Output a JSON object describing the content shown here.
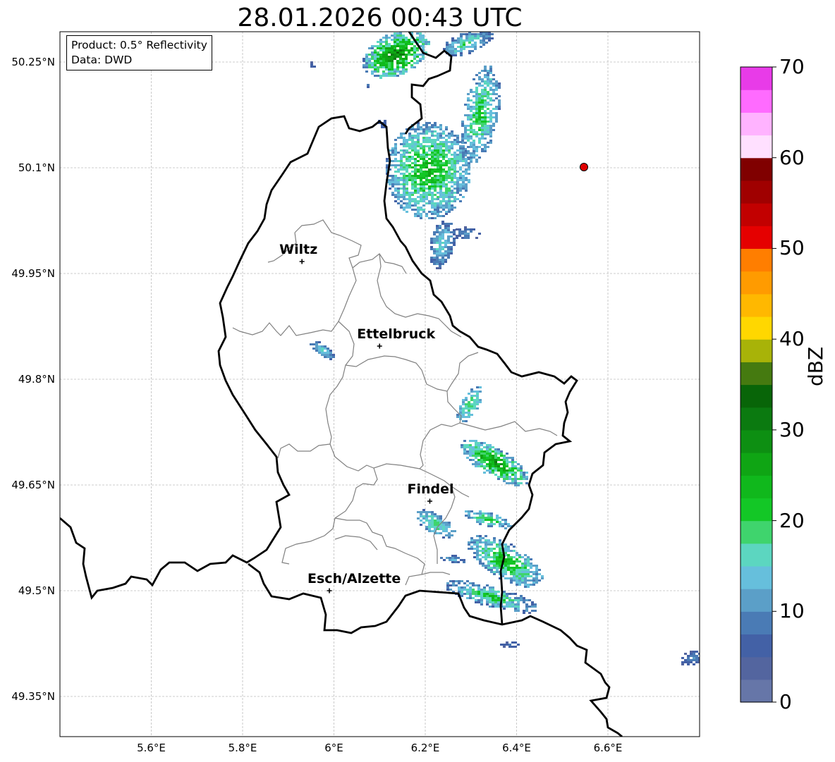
{
  "title": "28.01.2026 00:43 UTC",
  "info_box": {
    "product": "Product: 0.5° Reflectivity",
    "data_source": "Data: DWD"
  },
  "map": {
    "lon_range": [
      5.4,
      6.8
    ],
    "lat_range": [
      49.3,
      50.3
    ],
    "lat_ticks": [
      "50.25°N",
      "50.1°N",
      "49.95°N",
      "49.8°N",
      "49.65°N",
      "49.5°N",
      "49.35°N"
    ],
    "lon_ticks": [
      "5.6°E",
      "5.8°E",
      "6°E",
      "6.2°E",
      "6.4°E",
      "6.6°E"
    ],
    "grid": true,
    "border_color": "#000000",
    "canton_border_color": "#808080",
    "marker_color": "#e00000"
  },
  "cities": [
    {
      "name": "Wiltz",
      "lon": 5.93,
      "lat": 49.967
    },
    {
      "name": "Ettelbruck",
      "lon": 6.1,
      "lat": 49.847
    },
    {
      "name": "Findel",
      "lon": 6.21,
      "lat": 49.627
    },
    {
      "name": "Esch/Alzette",
      "lon": 5.99,
      "lat": 49.5
    }
  ],
  "colorbar": {
    "label": "dBZ",
    "ticks": [
      "0",
      "10",
      "20",
      "30",
      "40",
      "50",
      "60",
      "70"
    ],
    "range": [
      0,
      70
    ],
    "colors": [
      "#6676a8",
      "#53659f",
      "#4361a6",
      "#4a7bb5",
      "#5b9fc8",
      "#66bfdc",
      "#5cd6c0",
      "#3fd46d",
      "#13c726",
      "#10b81c",
      "#0fa514",
      "#0d8f12",
      "#0b7a10",
      "#086508",
      "#457a10",
      "#a8b308",
      "#ffd700",
      "#ffb800",
      "#ff9b00",
      "#ff7e00",
      "#e50000",
      "#c20000",
      "#a00000",
      "#800000",
      "#ffe0ff",
      "#ffb3ff",
      "#ff6bff",
      "#e83be8"
    ]
  }
}
